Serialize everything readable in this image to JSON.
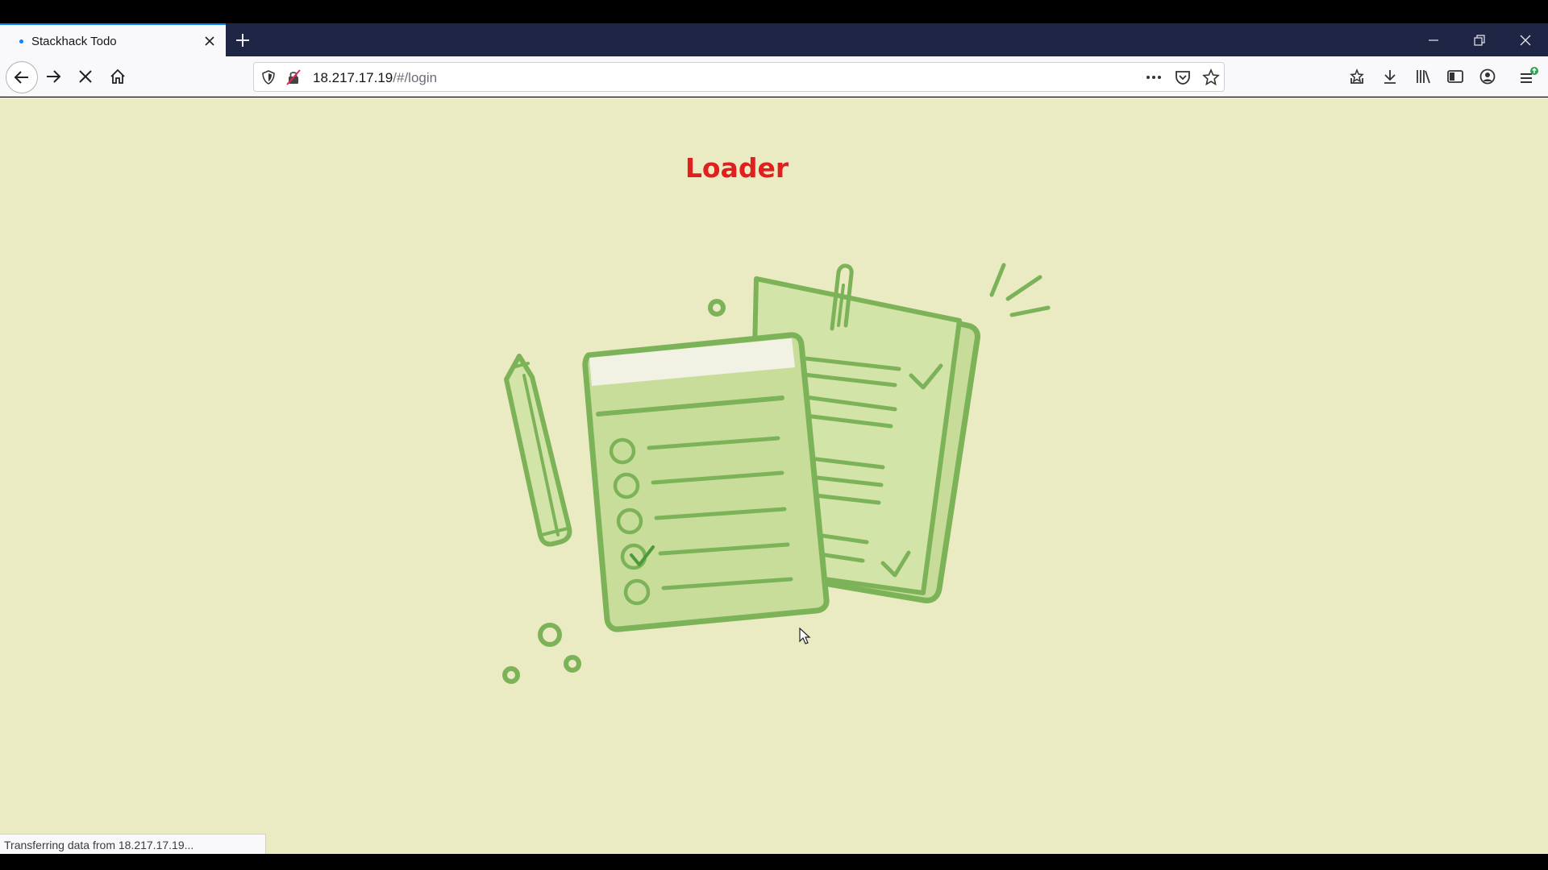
{
  "browser": {
    "tab": {
      "title": "Stackhack Todo"
    },
    "url": {
      "host": "18.217.17.19",
      "path": "/#/login"
    }
  },
  "page": {
    "heading": "Loader"
  },
  "status": {
    "text": "Transferring data from 18.217.17.19..."
  },
  "colors": {
    "heading": "#e01f1f",
    "background": "#eaeac3",
    "illustration_green": "#7db358"
  },
  "icons": [
    "close-icon",
    "plus-icon",
    "minimize-icon",
    "restore-icon",
    "back-icon",
    "forward-icon",
    "stop-icon",
    "home-icon",
    "shield-icon",
    "insecure-lock-icon",
    "more-icon",
    "pocket-icon",
    "star-icon",
    "library-download-icon",
    "download-icon",
    "library-icon",
    "sidebar-icon",
    "account-icon",
    "menu-icon"
  ]
}
